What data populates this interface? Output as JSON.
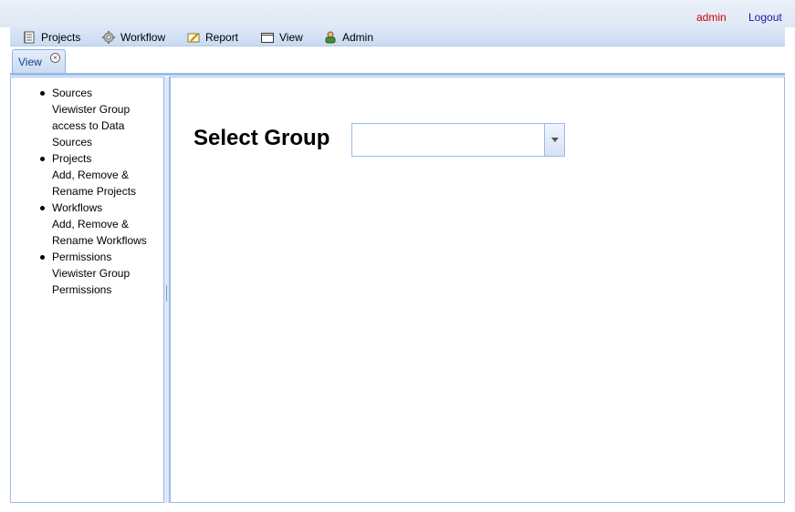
{
  "user": {
    "name": "admin",
    "logout_label": "Logout",
    "name_color": "#cc0000",
    "logout_color": "#1a1aa6"
  },
  "menu": {
    "items": [
      {
        "label": "Projects",
        "icon": "projects-icon"
      },
      {
        "label": "Workflow",
        "icon": "gear-icon"
      },
      {
        "label": "Report",
        "icon": "report-icon"
      },
      {
        "label": "View",
        "icon": "view-icon"
      },
      {
        "label": "Admin",
        "icon": "admin-icon"
      }
    ]
  },
  "tabs": [
    {
      "label": "View",
      "closable": true
    }
  ],
  "nav": {
    "items": [
      {
        "title": "Sources",
        "description": "Viewister Group access to Data Sources"
      },
      {
        "title": "Projects",
        "description": "Add, Remove & Rename Projects"
      },
      {
        "title": "Workflows",
        "description": "Add, Remove & Rename Workflows"
      },
      {
        "title": "Permissions",
        "description": "Viewister Group Permissions"
      }
    ]
  },
  "main": {
    "select_label": "Select Group",
    "select_value": ""
  },
  "colors": {
    "accent_border": "#99bbe8",
    "tab_text": "#15428b"
  }
}
